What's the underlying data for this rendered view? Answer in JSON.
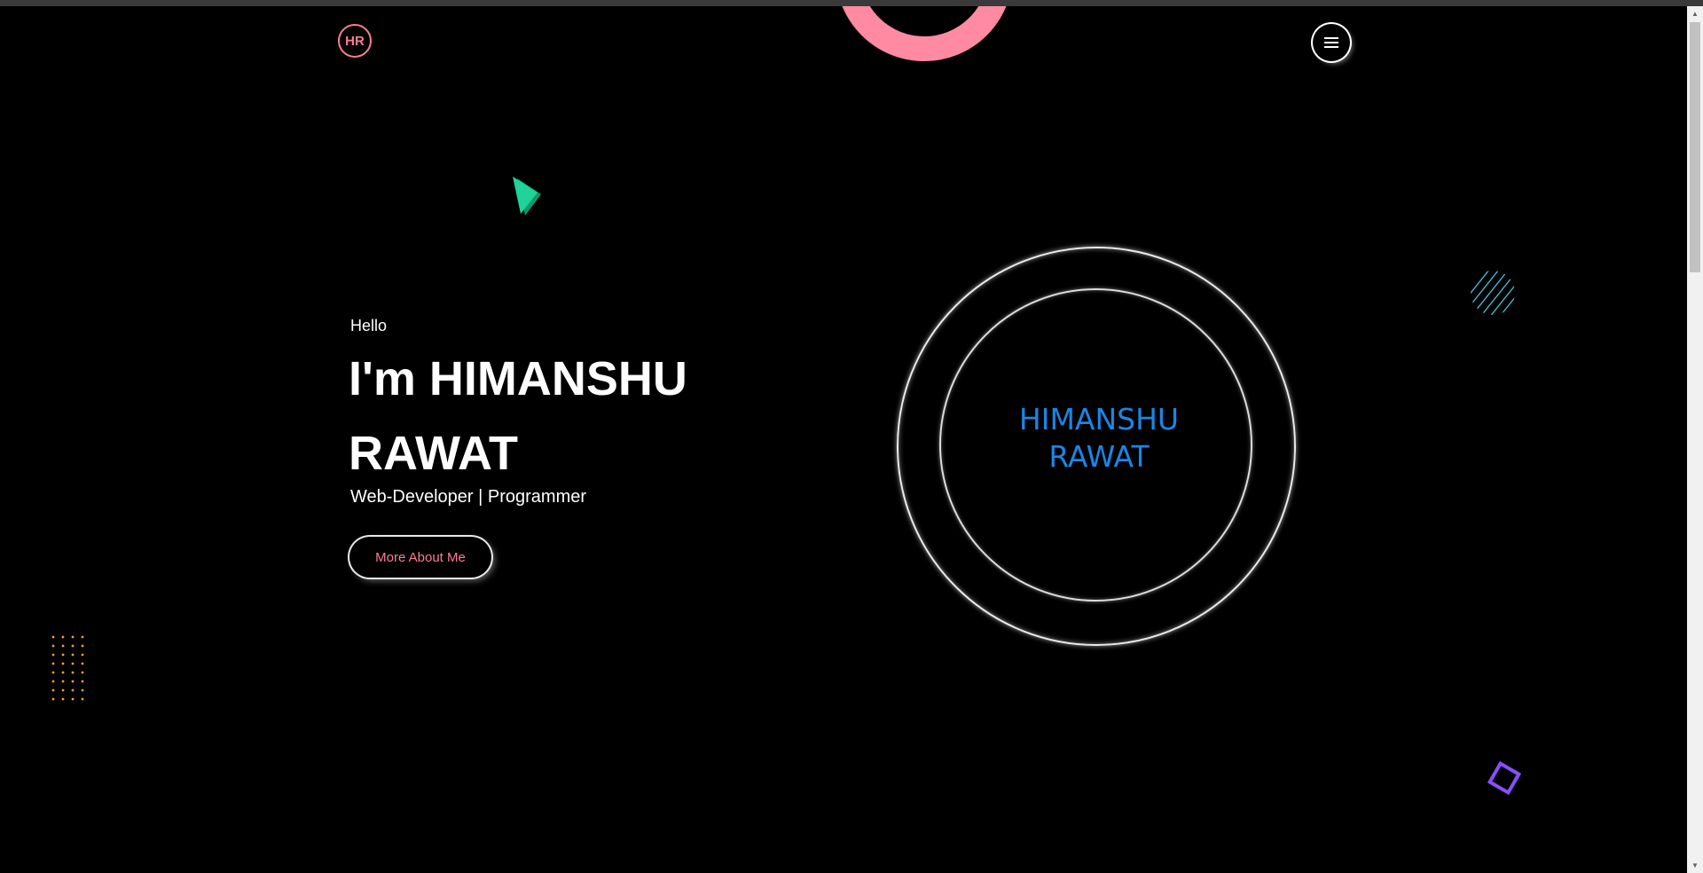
{
  "header": {
    "logo_text": "HR",
    "menu_icon": "hamburger-menu-icon"
  },
  "hero": {
    "greeting": "Hello",
    "name": "I'm HIMANSHU RAWAT",
    "role": "Web-Developer | Programmer",
    "cta_label": "More About Me"
  },
  "profile_ring": {
    "name_line1": "HIMANSHU",
    "name_line2": "RAWAT"
  },
  "decorations": {
    "pink_ring_color": "#ff8aa2",
    "green_triangle_color": "#1fd39a",
    "hatch_circle_color": "#4cc3e0",
    "dots_color": "#ff9f1c",
    "purple_square_color": "#8a4dff"
  },
  "colors": {
    "background": "#000000",
    "accent_pink": "#ff7c96",
    "accent_blue": "#1a86e6",
    "text": "#ffffff"
  }
}
